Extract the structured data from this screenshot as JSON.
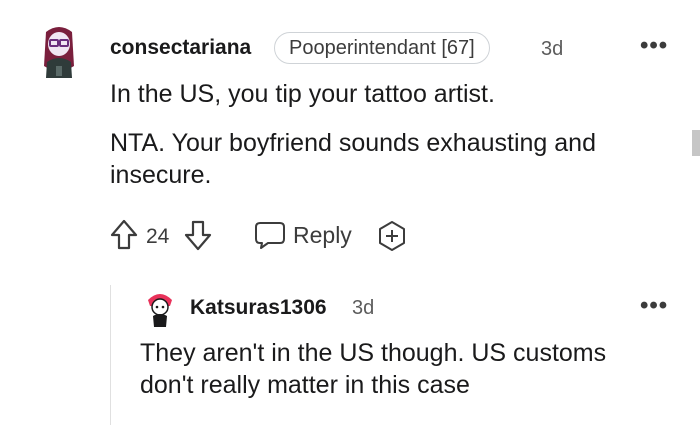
{
  "comment": {
    "username": "consectariana",
    "flair": "Pooperintendant [67]",
    "time": "3d",
    "body_line1": "In the US, you tip your tattoo artist.",
    "body_line2": "NTA. Your boyfriend sounds exhausting and",
    "body_line3": "insecure.",
    "vote_count": "24",
    "reply_label": "Reply",
    "more_label": "•••"
  },
  "reply": {
    "username": "Katsuras1306",
    "time": "3d",
    "body_line1": "They aren't in the US though. US customs",
    "body_line2": "don't really matter in this case",
    "more_label": "•••"
  },
  "icons": [
    "avatar",
    "upvote-icon",
    "downvote-icon",
    "reply-icon",
    "award-icon",
    "more-options-icon"
  ]
}
